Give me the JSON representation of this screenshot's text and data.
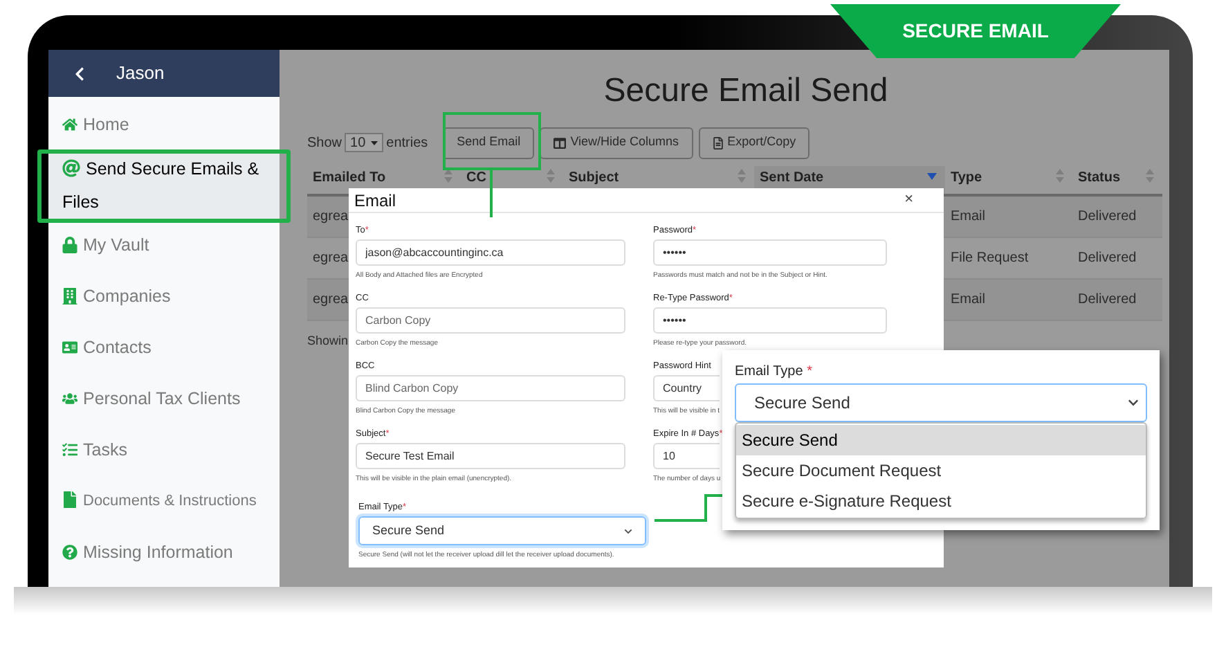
{
  "banner": "SECURE EMAIL",
  "sidebar": {
    "title": "Jason",
    "items": [
      {
        "label": "Home",
        "selected": false
      },
      {
        "label": "Send Secure Emails & Files",
        "selected": true
      },
      {
        "label": "My Vault",
        "selected": false
      },
      {
        "label": "Companies",
        "selected": false
      },
      {
        "label": "Contacts",
        "selected": false
      },
      {
        "label": "Personal Tax Clients",
        "selected": false
      },
      {
        "label": "Tasks",
        "selected": false
      },
      {
        "label": "Documents & Instructions",
        "selected": false
      },
      {
        "label": "Missing Information",
        "selected": false
      }
    ]
  },
  "page": {
    "title": "Secure Email Send",
    "show_label": "Show",
    "page_size": "10",
    "entries_label": "entries",
    "buttons": [
      "Send Email",
      "View/Hide Columns",
      "Export/Copy"
    ]
  },
  "table": {
    "columns": [
      {
        "label": "Emailed To",
        "sorted": false
      },
      {
        "label": "CC",
        "sorted": false
      },
      {
        "label": "Subject",
        "sorted": false
      },
      {
        "label": "Sent Date",
        "sorted": true
      },
      {
        "label": "Type",
        "sorted": false
      },
      {
        "label": "Status",
        "sorted": false
      }
    ],
    "rows": [
      {
        "emailed_to": "egrea",
        "type": "Email",
        "status": "Delivered"
      },
      {
        "emailed_to": "egrea",
        "type": "File Request",
        "status": "Delivered"
      },
      {
        "emailed_to": "egrea",
        "type": "Email",
        "status": "Delivered"
      }
    ],
    "footer": "Showin"
  },
  "modal": {
    "title": "Email",
    "close": "×",
    "left_fields": [
      {
        "kind": "text",
        "label": "To",
        "required_mark": "*",
        "value": "jason@abcaccountinginc.ca",
        "help": "All Body and Attached files are Encrypted"
      },
      {
        "kind": "text",
        "label": "CC",
        "placeholder": "Carbon Copy",
        "help": "Carbon Copy the message"
      },
      {
        "kind": "text",
        "label": "BCC",
        "placeholder": "Blind Carbon Copy",
        "help": "Blind Carbon Copy the message"
      },
      {
        "kind": "text",
        "label": "Subject",
        "required_mark": "*",
        "value": "Secure Test Email",
        "help": "This will be visible in the plain email (unencrypted)."
      },
      {
        "kind": "select",
        "label": "Email Type",
        "required_mark": "*",
        "value": "Secure Send",
        "help": "Secure Send (will not let the receiver upload dill let the receiver upload documents)."
      }
    ],
    "right_fields": [
      {
        "kind": "text",
        "label": "Password",
        "required_mark": "*",
        "value": "••••••",
        "help": "Passwords must match and not be in the Subject or Hint."
      },
      {
        "kind": "text",
        "label": "Re-Type Password",
        "required_mark": "*",
        "value": "••••••",
        "help": "Please re-type your password."
      },
      {
        "kind": "text",
        "label": "Password Hint",
        "value": "Country",
        "help": "This will be visible in t"
      },
      {
        "kind": "text",
        "label": "Expire In # Days",
        "required_mark": "*",
        "value": "10",
        "help": "The number of days u"
      }
    ]
  },
  "callout": {
    "label": "Email Type",
    "required_mark": "*",
    "value": "Secure Send",
    "options": [
      {
        "label": "Secure Send",
        "selected": true
      },
      {
        "label": "Secure Document Request",
        "selected": false
      },
      {
        "label": "Secure e-Signature Request",
        "selected": false
      }
    ]
  }
}
